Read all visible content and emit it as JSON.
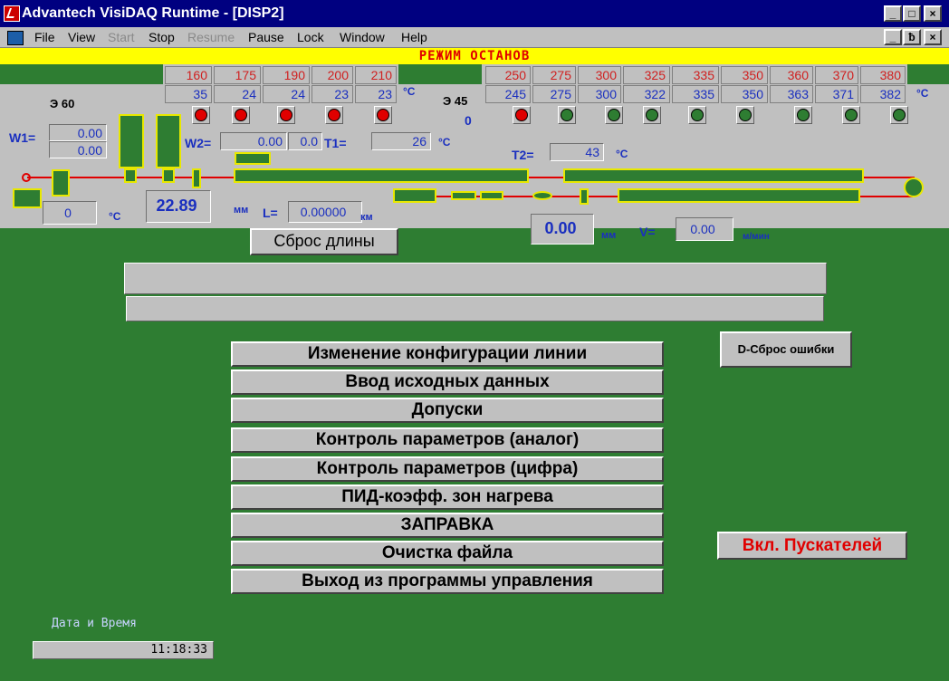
{
  "window": {
    "title": "Advantech VisiDAQ Runtime - [DISP2]",
    "min_glyph": "_",
    "max_glyph": "□",
    "close_glyph": "×",
    "restore_glyph": "ƀ"
  },
  "menu": {
    "items": [
      {
        "label": "File",
        "disabled": false
      },
      {
        "label": "View",
        "disabled": false
      },
      {
        "label": "Start",
        "disabled": true
      },
      {
        "label": "Stop",
        "disabled": false
      },
      {
        "label": "Resume",
        "disabled": true
      },
      {
        "label": "Pause",
        "disabled": false
      },
      {
        "label": "Lock",
        "disabled": false
      },
      {
        "label": "Window",
        "disabled": false
      },
      {
        "label": "Help",
        "disabled": false
      }
    ]
  },
  "banner": {
    "text": "РЕЖИМ ОСТАНОВ"
  },
  "extruder1": {
    "label": "Э 60",
    "setpoints": [
      "160",
      "175",
      "190",
      "200",
      "210"
    ],
    "actuals": [
      "35",
      "24",
      "24",
      "23",
      "23"
    ],
    "unit": "°C",
    "leds": [
      "red",
      "red",
      "red",
      "red",
      "red"
    ]
  },
  "extruder2": {
    "label": "Э 45",
    "value": "0",
    "setpoints": [
      "250",
      "275",
      "300",
      "325",
      "335",
      "350",
      "360",
      "370",
      "380"
    ],
    "actuals": [
      "245",
      "275",
      "300",
      "322",
      "335",
      "350",
      "363",
      "371",
      "382"
    ],
    "unit": "°C",
    "leds": [
      "red",
      "green",
      "green",
      "green",
      "green",
      "green",
      "green",
      "green",
      "green"
    ]
  },
  "params": {
    "w1_label": "W1=",
    "w1_value_a": "0.00",
    "w1_value_b": "0.00",
    "w2_label": "W2=",
    "w2_value": "0.00",
    "w2_value2": "0.0",
    "t1_label": "T1=",
    "t1_value": "26",
    "t1_unit": "°C",
    "t2_label": "T2=",
    "t2_value": "43",
    "t2_unit": "°C",
    "temp_value": "0",
    "temp_unit": "°C",
    "diameter_value": "22.89",
    "diameter_unit": "мм",
    "length_label": "L=",
    "length_value": "0.00000",
    "length_unit": "км",
    "thickness_value": "0.00",
    "thickness_unit": "мм",
    "speed_label": "V=",
    "speed_value": "0.00",
    "speed_unit": "м/мин"
  },
  "buttons": {
    "reset_length": "Сброс длины",
    "reset_error": "D-Сброс ошибки",
    "starters_on": "Вкл. Пускателей"
  },
  "main_menu": [
    "Изменение конфигурации линии",
    "Ввод исходных данных",
    "Допуски",
    "Контроль параметров (аналог)",
    "Контроль параметров (цифра)",
    "ПИД-коэфф. зон нагрева",
    "ЗАПРАВКА",
    "Очистка файла",
    "Выход из программы управления"
  ],
  "datetime": {
    "label": "Дата и Время",
    "time": "11:18:33"
  },
  "colors": {
    "panel_green": "#2e7d32",
    "panel_gray": "#c0c0c0",
    "banner_yellow": "#ffff00",
    "alarm_red": "#e00000",
    "value_blue": "#1a2fbf"
  }
}
